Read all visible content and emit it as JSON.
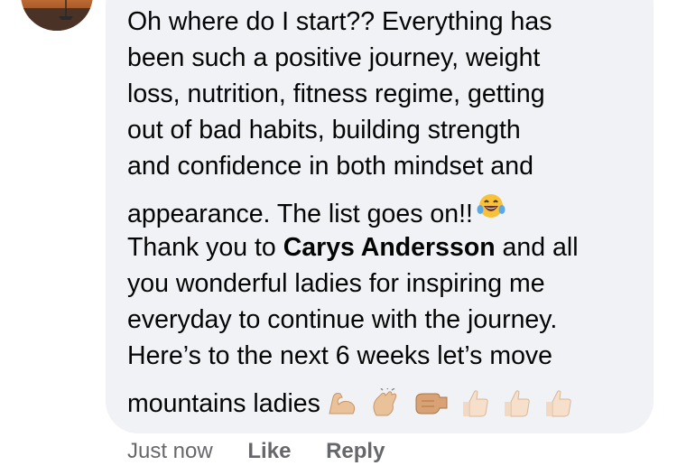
{
  "comment": {
    "lines": [
      "Oh where do I start?? Everything has",
      "been such a positive journey, weight",
      "loss, nutrition, fitness regime, getting",
      "out of bad habits, building strength",
      "and confidence in both mindset and",
      "appearance. The list goes on!!"
    ],
    "line_thank_prefix": "Thank you to ",
    "mention": "Carys Andersson",
    "line_thank_suffix": " and all",
    "lines_after": [
      "you wonderful ladies for inspiring me",
      "everyday to continue with the journey.",
      "Here’s to the next 6 weeks let’s move"
    ],
    "last_line": "mountains ladies",
    "emoji_after_list": "laughing-tears-emoji",
    "emoji_end": [
      "flexed-biceps-emoji",
      "clapping-hands-emoji",
      "left-facing-fist-emoji",
      "thumbs-up-emoji",
      "thumbs-up-emoji",
      "thumbs-up-emoji"
    ]
  },
  "actions": {
    "timestamp": "Just now",
    "like_label": "Like",
    "reply_label": "Reply"
  },
  "colors": {
    "bubble": "#f0f2f5",
    "text": "#050505",
    "meta": "#65676b"
  }
}
